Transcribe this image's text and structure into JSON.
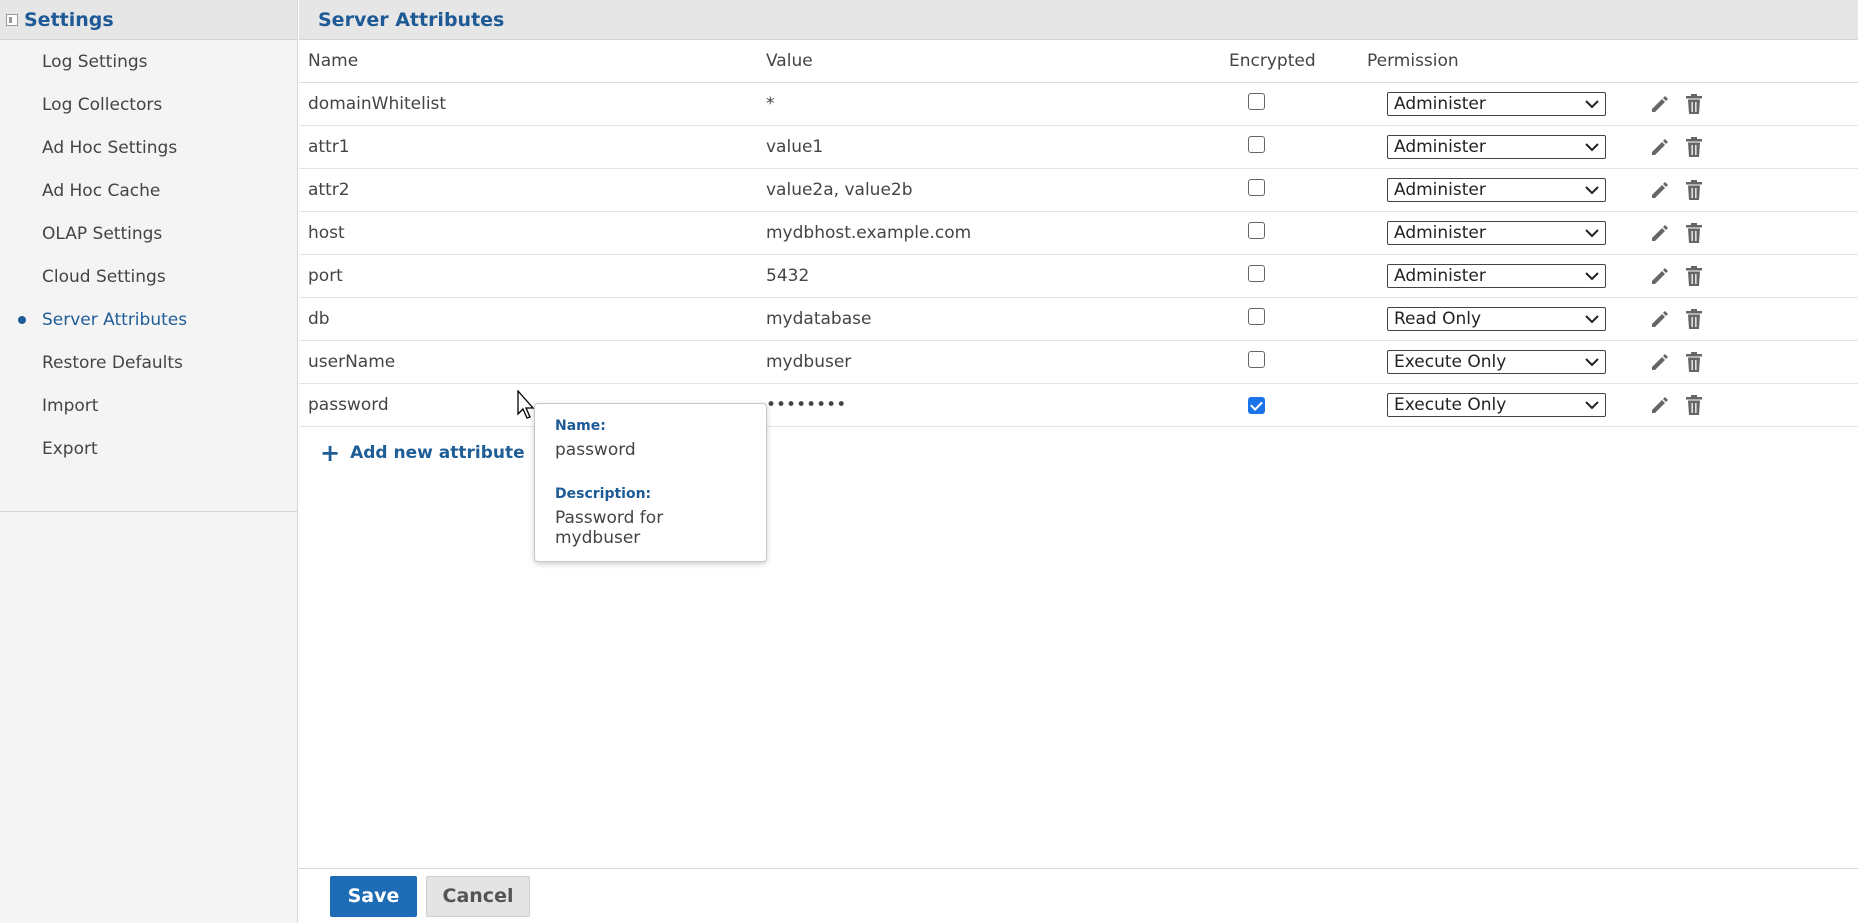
{
  "sidebar": {
    "title": "Settings",
    "items": [
      {
        "label": "Log Settings"
      },
      {
        "label": "Log Collectors"
      },
      {
        "label": "Ad Hoc Settings"
      },
      {
        "label": "Ad Hoc Cache"
      },
      {
        "label": "OLAP Settings"
      },
      {
        "label": "Cloud Settings"
      },
      {
        "label": "Server Attributes"
      },
      {
        "label": "Restore Defaults"
      },
      {
        "label": "Import"
      },
      {
        "label": "Export"
      }
    ],
    "active_index": 6
  },
  "main": {
    "title": "Server Attributes",
    "columns": {
      "name": "Name",
      "value": "Value",
      "encrypted": "Encrypted",
      "permission": "Permission"
    },
    "rows": [
      {
        "name": "domainWhitelist",
        "value": "*",
        "encrypted": false,
        "permission": "Administer"
      },
      {
        "name": "attr1",
        "value": "value1",
        "encrypted": false,
        "permission": "Administer"
      },
      {
        "name": "attr2",
        "value": "value2a, value2b",
        "encrypted": false,
        "permission": "Administer"
      },
      {
        "name": "host",
        "value": "mydbhost.example.com",
        "encrypted": false,
        "permission": "Administer"
      },
      {
        "name": "port",
        "value": "5432",
        "encrypted": false,
        "permission": "Administer"
      },
      {
        "name": "db",
        "value": "mydatabase",
        "encrypted": false,
        "permission": "Read Only"
      },
      {
        "name": "userName",
        "value": "mydbuser",
        "encrypted": false,
        "permission": "Execute Only"
      },
      {
        "name": "password",
        "value": "••••••••",
        "encrypted": true,
        "permission": "Execute Only"
      }
    ],
    "add_label": "Add new attribute"
  },
  "tooltip": {
    "name_label": "Name:",
    "name_value": "password",
    "desc_label": "Description:",
    "desc_value": "Password for mydbuser"
  },
  "footer": {
    "save_label": "Save",
    "cancel_label": "Cancel"
  },
  "colors": {
    "accent": "#1e5a96",
    "primary_button": "#1e6cb5",
    "checkbox_on": "#1a73e8"
  },
  "icons": {
    "edit": "pencil-icon",
    "delete": "trash-icon",
    "add": "plus-icon",
    "collapse": "panel-collapse-icon"
  }
}
